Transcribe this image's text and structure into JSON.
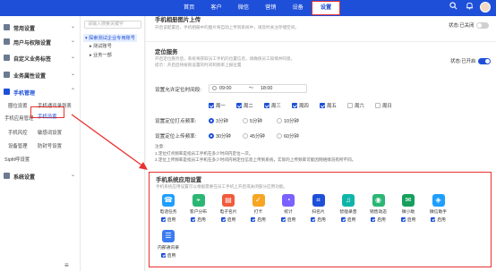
{
  "topnav": {
    "items": [
      "首页",
      "客户",
      "微信",
      "营销",
      "设备",
      "设置"
    ],
    "active_index": 5
  },
  "topicons": [
    "search-icon",
    "bell-icon",
    "avatar"
  ],
  "sidebar": {
    "sections": [
      "常用设置",
      "用户与权限设置",
      "自定义业务标签",
      "业务属性设置",
      "手机管理",
      "系统设置"
    ],
    "sub_items": [
      "圈位设置",
      "手机通讯录列表",
      "手机应用管理",
      "手机设置",
      "手机风控",
      "敏感词设置",
      "设备管理",
      "防封号设置",
      "Sipfit呼设置"
    ],
    "active_sub": "手机设置",
    "foot_icon": "≡"
  },
  "tree": {
    "search_placeholder": "请输入搜索关键字",
    "items": [
      "探索测试企业专用账号",
      "测试账号",
      "业务一部"
    ]
  },
  "main": {
    "upload": {
      "title": "手机相册图片上传",
      "desc": "开启该配置后，手机相册中的图片将自动上传到系统中，请及时关注存储空间。",
      "status": "状态:已关闭"
    },
    "location": {
      "title": "定位服务",
      "desc": "开启定位服务后，系统将获取员工手机的位置信息，请确保员工知情并同意。",
      "sub_desc": "提示：开启后将按照设置的时间和频率上报位置",
      "status": "状态:已开启",
      "allow_time_label": "设置允许定位时间段:",
      "time_start": "09:00",
      "time_sep": "～",
      "time_end": "18:00",
      "days": [
        "周一",
        "周二",
        "周三",
        "周四",
        "周五",
        "周六",
        "周日"
      ],
      "days_checked": [
        true,
        true,
        true,
        true,
        true,
        false,
        false
      ],
      "punch_label": "设置定位打点频率:",
      "punch_options": [
        "3分钟",
        "5分钟",
        "10分钟"
      ],
      "punch_selected": 0,
      "upload_label": "设置定位上传频率:",
      "upload_options": [
        "30分钟",
        "45分钟",
        "60分钟"
      ],
      "upload_selected": 0,
      "note_title": "注意:",
      "note_1": "1.定位打点频率是指员工手机在多少时间内定位一次。",
      "note_2": "2.定位上传频率是指员工手机在多少时间内将定位信息上传到系统，实际的上传频率可能因网络情况有所不同。"
    },
    "apps": {
      "title": "手机系统应用设置",
      "desc": "手机系统应用设置可以根据需要在员工手机上开启或关闭部分应用功能。",
      "enable_label": "启用",
      "items": [
        {
          "name": "电话任务",
          "icon": "phone-task-icon",
          "color": "#1e9fff",
          "glyph": "☎"
        },
        {
          "name": "客户分布",
          "icon": "customer-map-icon",
          "color": "#2bb673",
          "glyph": "⌖"
        },
        {
          "name": "电子名片",
          "icon": "ecard-icon",
          "color": "#f15a3c",
          "glyph": "▤"
        },
        {
          "name": "打卡",
          "icon": "clock-in-icon",
          "color": "#f6a623",
          "glyph": "✓"
        },
        {
          "name": "统计",
          "icon": "statistics-icon",
          "color": "#7b61ff",
          "glyph": "◔"
        },
        {
          "name": "扫名片",
          "icon": "scan-card-icon",
          "color": "#1e4fd8",
          "glyph": "⌗"
        },
        {
          "name": "智能录音",
          "icon": "voice-record-icon",
          "color": "#0fb5a8",
          "glyph": "♫"
        },
        {
          "name": "销售动态",
          "icon": "sales-feed-icon",
          "color": "#2bb673",
          "glyph": "◉"
        },
        {
          "name": "微小助",
          "icon": "wechat-assistant-icon",
          "color": "#17a05d",
          "glyph": "✉"
        },
        {
          "name": "微信助手",
          "icon": "wechat-helper-icon",
          "color": "#1e9fff",
          "glyph": "◈"
        },
        {
          "name": "内部通讯录",
          "icon": "internal-contacts-icon",
          "color": "#3c7cf0",
          "glyph": "☰"
        }
      ]
    }
  }
}
